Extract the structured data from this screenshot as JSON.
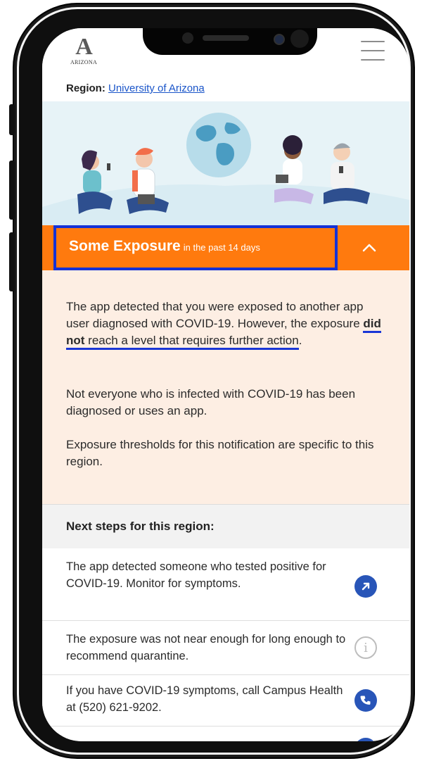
{
  "header": {
    "logo_letter": "A",
    "logo_text": "ARIZONA",
    "menu_icon": "hamburger-menu-icon"
  },
  "region": {
    "label": "Region:",
    "value": "University of Arizona"
  },
  "exposure": {
    "title": "Some Exposure",
    "subtitle": "in the past 14 days",
    "toggle_icon": "chevron-up-icon",
    "color": "#ff7a0e",
    "highlight_color": "#1432d6"
  },
  "details": {
    "p1_start": "The app detected that you were exposed to another app user diagnosed with COVID-19. However, the exposure ",
    "p1_bold": "did not",
    "p1_underlined": " reach a level that requires further action",
    "p1_end": ".",
    "p2": "Not everyone who is infected with COVID-19 has been diagnosed or uses an app.",
    "p3": "Exposure thresholds for this notification are specific to this region."
  },
  "next_steps": {
    "title": "Next steps for this region:",
    "items": [
      {
        "text": "The app detected someone who tested positive for COVID-19. Monitor for symptoms.",
        "icon": "arrow-up-right-icon"
      },
      {
        "text": "The exposure was not near enough for long enough to recommend quarantine.",
        "icon": "info-icon"
      },
      {
        "text": "If you have COVID-19 symptoms, call Campus Health at (520) 621-9202.",
        "icon": "phone-icon"
      },
      {
        "text": "",
        "icon": "arrow-icon"
      }
    ]
  }
}
